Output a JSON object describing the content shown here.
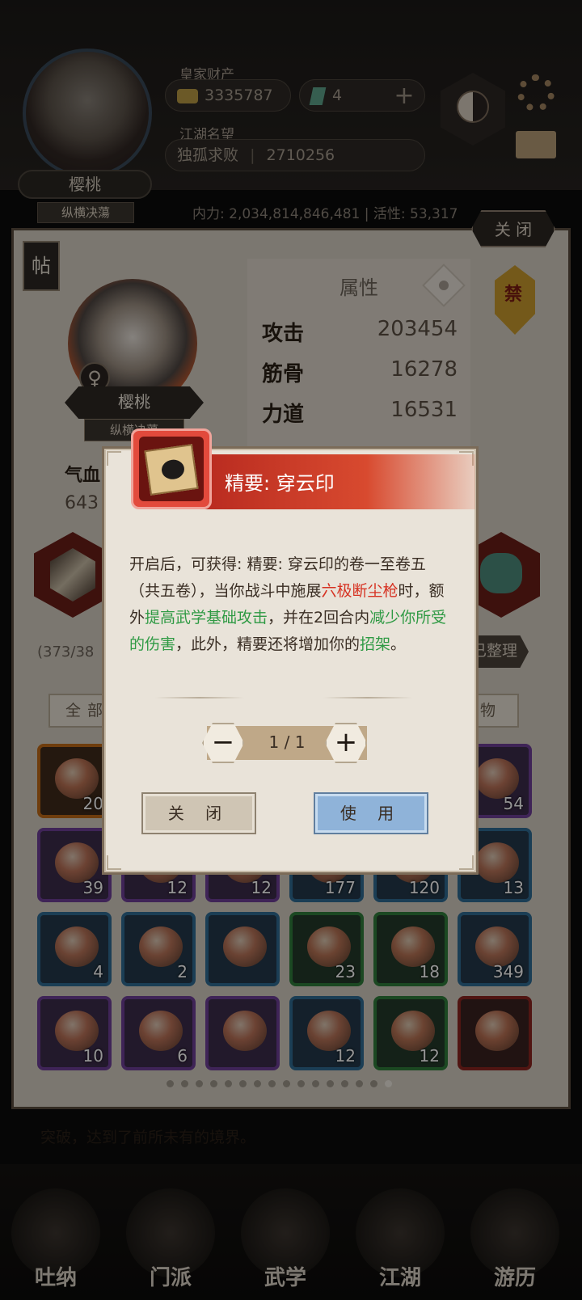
{
  "topbar": {
    "wealth_label": "皇家财产",
    "gold": "3335787",
    "gems": "4",
    "fame_label": "江湖名望",
    "fame_title": "独孤求败",
    "fame_value": "2710256",
    "player_name": "樱桃",
    "player_title": "纵横决蕩"
  },
  "stats_line": "内力: 2,034,814,846,481 | 活性: 53,317",
  "panel": {
    "close_label": "关 闭",
    "tie_icon_text": "帖",
    "char_name": "樱桃",
    "char_title": "纵横决蕩",
    "attr_title": "属性",
    "ban_text": "禁",
    "attributes": [
      {
        "name": "攻击",
        "value": "203454"
      },
      {
        "name": "筋骨",
        "value": "16278"
      },
      {
        "name": "力道",
        "value": "16531"
      }
    ],
    "hp_label": "气血",
    "hp_value": "643",
    "capacity": "(373/38",
    "sorted_label": "已整理",
    "tab_all": "全部",
    "tab_misc": "杂物"
  },
  "inventory": [
    {
      "count": "20",
      "rarity": "orange"
    },
    {
      "count": "",
      "rarity": "purple"
    },
    {
      "count": "",
      "rarity": "purple"
    },
    {
      "count": "",
      "rarity": "blue"
    },
    {
      "count": "",
      "rarity": "blue"
    },
    {
      "count": "54",
      "rarity": "purple"
    },
    {
      "count": "39",
      "rarity": "purple"
    },
    {
      "count": "12",
      "rarity": "purple"
    },
    {
      "count": "12",
      "rarity": "purple"
    },
    {
      "count": "177",
      "rarity": "blue"
    },
    {
      "count": "120",
      "rarity": "blue"
    },
    {
      "count": "13",
      "rarity": "blue"
    },
    {
      "count": "4",
      "rarity": "blue"
    },
    {
      "count": "2",
      "rarity": "blue"
    },
    {
      "count": "",
      "rarity": "blue"
    },
    {
      "count": "23",
      "rarity": "green"
    },
    {
      "count": "18",
      "rarity": "green"
    },
    {
      "count": "349",
      "rarity": "blue"
    },
    {
      "count": "10",
      "rarity": "purple"
    },
    {
      "count": "6",
      "rarity": "purple"
    },
    {
      "count": "",
      "rarity": "purple"
    },
    {
      "count": "12",
      "rarity": "blue"
    },
    {
      "count": "12",
      "rarity": "green"
    },
    {
      "count": "",
      "rarity": "red"
    }
  ],
  "story": {
    "line1": "突破，达到了前所未有的境界。"
  },
  "nav": [
    "吐纳",
    "门派",
    "武学",
    "江湖",
    "游历"
  ],
  "modal": {
    "title": "精要: 穿云印",
    "desc": {
      "p1": "开启后，可获得: 精要: 穿云印的卷一至卷五（共五卷），当你战斗中施展",
      "skill": "六极断尘枪",
      "p2": "时，额外",
      "buff1": "提高武学基础攻击",
      "p3": "，并在2回合内",
      "buff2": "减少你所受的伤害",
      "p4": "，此外，精要还将增加你的",
      "buff3": "招架",
      "p5": "。"
    },
    "quantity": "1 / 1",
    "minus": "−",
    "plus": "+",
    "close_label": "关 闭",
    "use_label": "使 用"
  }
}
